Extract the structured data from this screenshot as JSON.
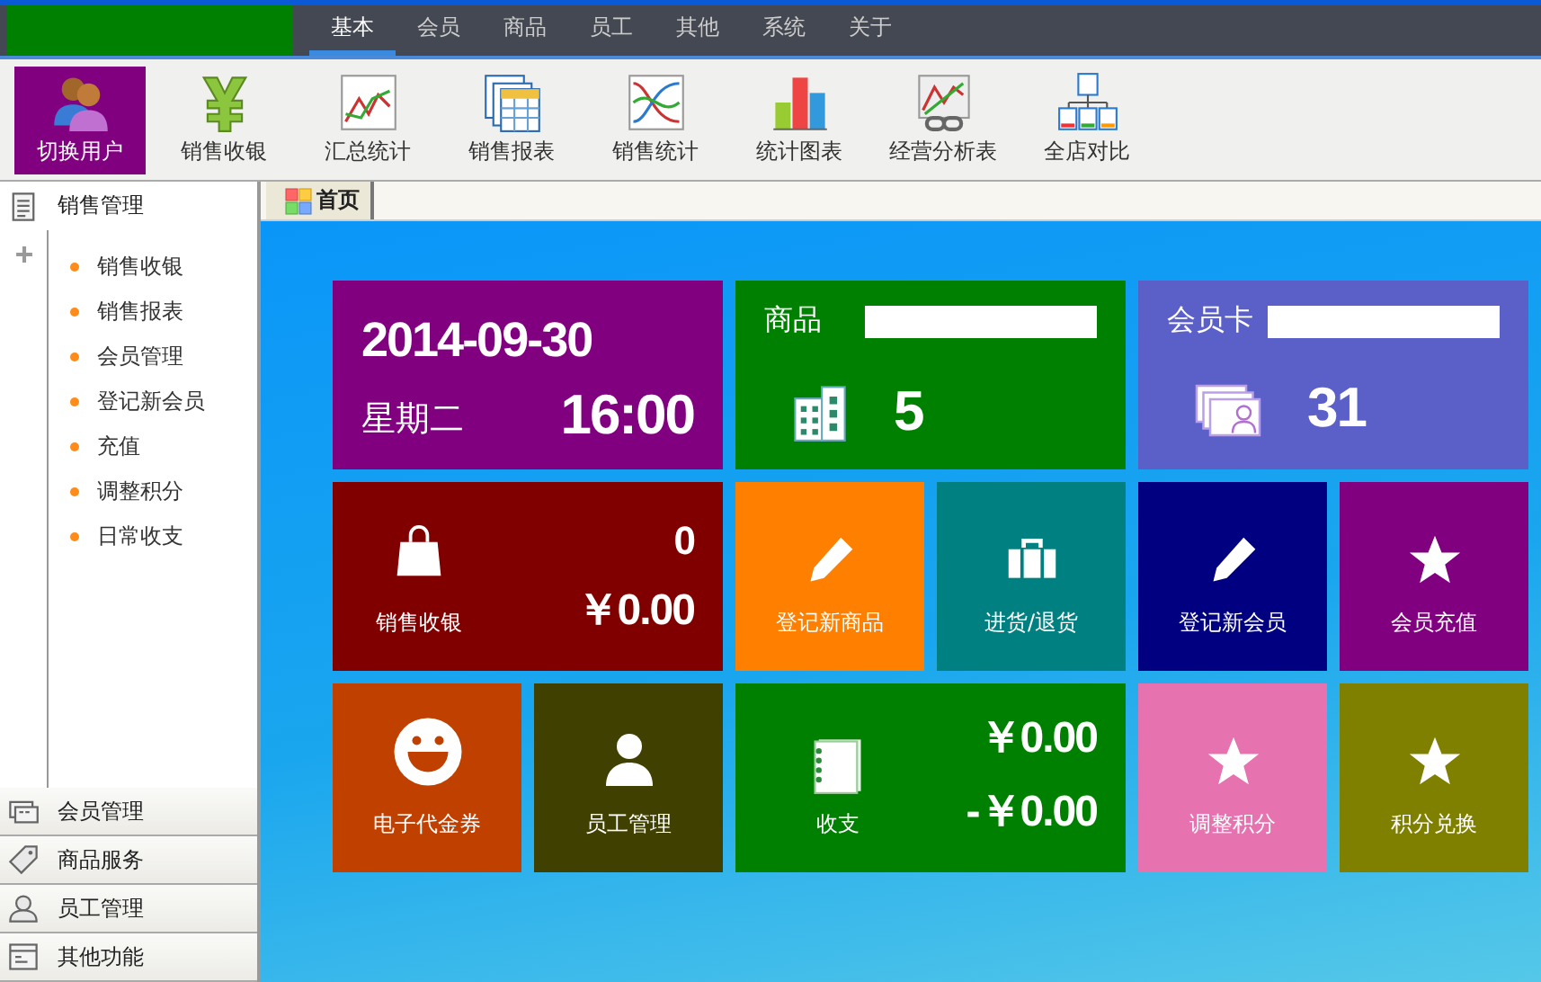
{
  "top_menu": [
    {
      "label": "基本",
      "selected": true
    },
    {
      "label": "会员",
      "selected": false
    },
    {
      "label": "商品",
      "selected": false
    },
    {
      "label": "员工",
      "selected": false
    },
    {
      "label": "其他",
      "selected": false
    },
    {
      "label": "系统",
      "selected": false
    },
    {
      "label": "关于",
      "selected": false
    }
  ],
  "toolbar": [
    {
      "label": "切换用户",
      "selected": true
    },
    {
      "label": "销售收银",
      "selected": false
    },
    {
      "label": "汇总统计",
      "selected": false
    },
    {
      "label": "销售报表",
      "selected": false
    },
    {
      "label": "销售统计",
      "selected": false
    },
    {
      "label": "统计图表",
      "selected": false
    },
    {
      "label": "经营分析表",
      "selected": false
    },
    {
      "label": "全店对比",
      "selected": false
    }
  ],
  "sidebar": {
    "sections": [
      {
        "label": "销售管理",
        "expanded": true,
        "items": [
          "销售收银",
          "销售报表",
          "会员管理",
          "登记新会员",
          "充值",
          "调整积分",
          "日常收支"
        ]
      },
      {
        "label": "会员管理",
        "expanded": false
      },
      {
        "label": "商品服务",
        "expanded": false
      },
      {
        "label": "员工管理",
        "expanded": false
      },
      {
        "label": "其他功能",
        "expanded": false
      }
    ]
  },
  "tabs": [
    {
      "label": "首页",
      "selected": true
    }
  ],
  "tiles": [
    {
      "kind": "date",
      "color": "#800080",
      "date": "2014-09-30",
      "weekday": "星期二",
      "time": "16:00"
    },
    {
      "kind": "lookup",
      "color": "#008000",
      "label": "商品",
      "count": "5"
    },
    {
      "kind": "lookup",
      "color": "#5b5fc8",
      "label": "会员卡",
      "count": "31"
    },
    {
      "kind": "sales",
      "color": "#800000",
      "label": "销售收银",
      "count": "0",
      "amount": "￥0.00"
    },
    {
      "kind": "action",
      "color": "#ff8000",
      "label": "登记新商品"
    },
    {
      "kind": "action",
      "color": "#008080",
      "label": "进货/退货"
    },
    {
      "kind": "action",
      "color": "#000080",
      "label": "登记新会员"
    },
    {
      "kind": "action",
      "color": "#800080",
      "label": "会员充值"
    },
    {
      "kind": "action",
      "color": "#c04000",
      "label": "电子代金券"
    },
    {
      "kind": "action",
      "color": "#404000",
      "label": "员工管理"
    },
    {
      "kind": "ledger",
      "color": "#008000",
      "label": "收支",
      "income": "￥0.00",
      "expense": "-￥0.00"
    },
    {
      "kind": "action",
      "color": "#e673b0",
      "label": "调整积分"
    },
    {
      "kind": "action",
      "color": "#808000",
      "label": "积分兑换"
    }
  ]
}
